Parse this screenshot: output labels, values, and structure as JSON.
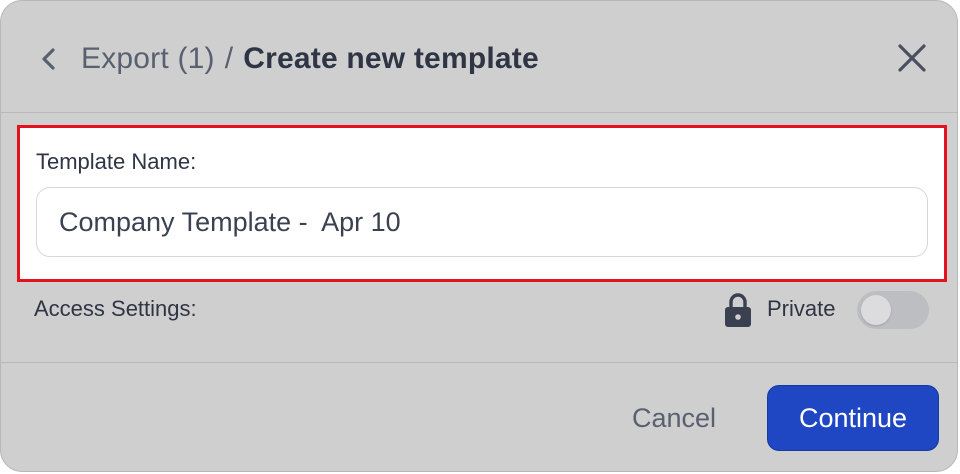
{
  "header": {
    "back_icon": "chevron-left-icon",
    "breadcrumb_parent": "Export (1)",
    "breadcrumb_separator": "/",
    "title": "Create new template",
    "close_icon": "close-icon"
  },
  "form": {
    "template_name_label": "Template Name:",
    "template_name_value": "Company Template -  Apr 10",
    "access_settings_label": "Access Settings:",
    "lock_icon": "lock-icon",
    "private_label": "Private",
    "private_enabled": false
  },
  "footer": {
    "cancel_label": "Cancel",
    "continue_label": "Continue"
  },
  "colors": {
    "dialog_background": "#cfcfd0",
    "primary_button": "#1f46c3",
    "highlight_border": "#e3121c",
    "text_primary": "#2f3544",
    "text_secondary": "#596070"
  }
}
